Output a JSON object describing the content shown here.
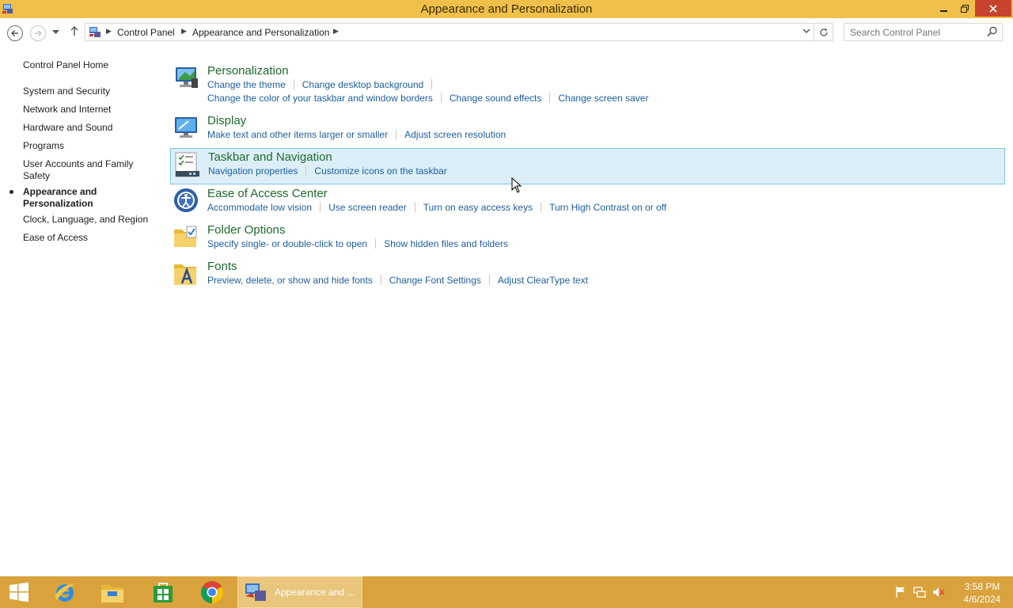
{
  "window": {
    "title": "Appearance and Personalization"
  },
  "navbar": {
    "breadcrumb": [
      "Control Panel",
      "Appearance and Personalization"
    ],
    "search_placeholder": "Search Control Panel"
  },
  "sidebar": {
    "items": [
      {
        "label": "Control Panel Home"
      },
      {
        "label": "System and Security"
      },
      {
        "label": "Network and Internet"
      },
      {
        "label": "Hardware and Sound"
      },
      {
        "label": "Programs"
      },
      {
        "label": "User Accounts and Family Safety"
      },
      {
        "label": "Appearance and Personalization",
        "active": true
      },
      {
        "label": "Clock, Language, and Region"
      },
      {
        "label": "Ease of Access"
      }
    ]
  },
  "categories": [
    {
      "title": "Personalization",
      "links": [
        "Change the theme",
        "Change desktop background",
        "Change the color of your taskbar and window borders",
        "Change sound effects",
        "Change screen saver"
      ]
    },
    {
      "title": "Display",
      "links": [
        "Make text and other items larger or smaller",
        "Adjust screen resolution"
      ]
    },
    {
      "title": "Taskbar and Navigation",
      "links": [
        "Navigation properties",
        "Customize icons on the taskbar"
      ],
      "highlighted": true
    },
    {
      "title": "Ease of Access Center",
      "links": [
        "Accommodate low vision",
        "Use screen reader",
        "Turn on easy access keys",
        "Turn High Contrast on or off"
      ]
    },
    {
      "title": "Folder Options",
      "links": [
        "Specify single- or double-click to open",
        "Show hidden files and folders"
      ]
    },
    {
      "title": "Fonts",
      "links": [
        "Preview, delete, or show and hide fonts",
        "Change Font Settings",
        "Adjust ClearType text"
      ]
    }
  ],
  "taskbar": {
    "active_window_label": "Appearance and ...",
    "clock_time": "3:58 PM",
    "clock_date": "4/6/2024"
  },
  "colors": {
    "titlebar": "#f0c04a",
    "taskbar": "#d9a23c",
    "category_title": "#1e6a2d",
    "link": "#1e5fa0",
    "highlight_bg": "#dceff8"
  }
}
